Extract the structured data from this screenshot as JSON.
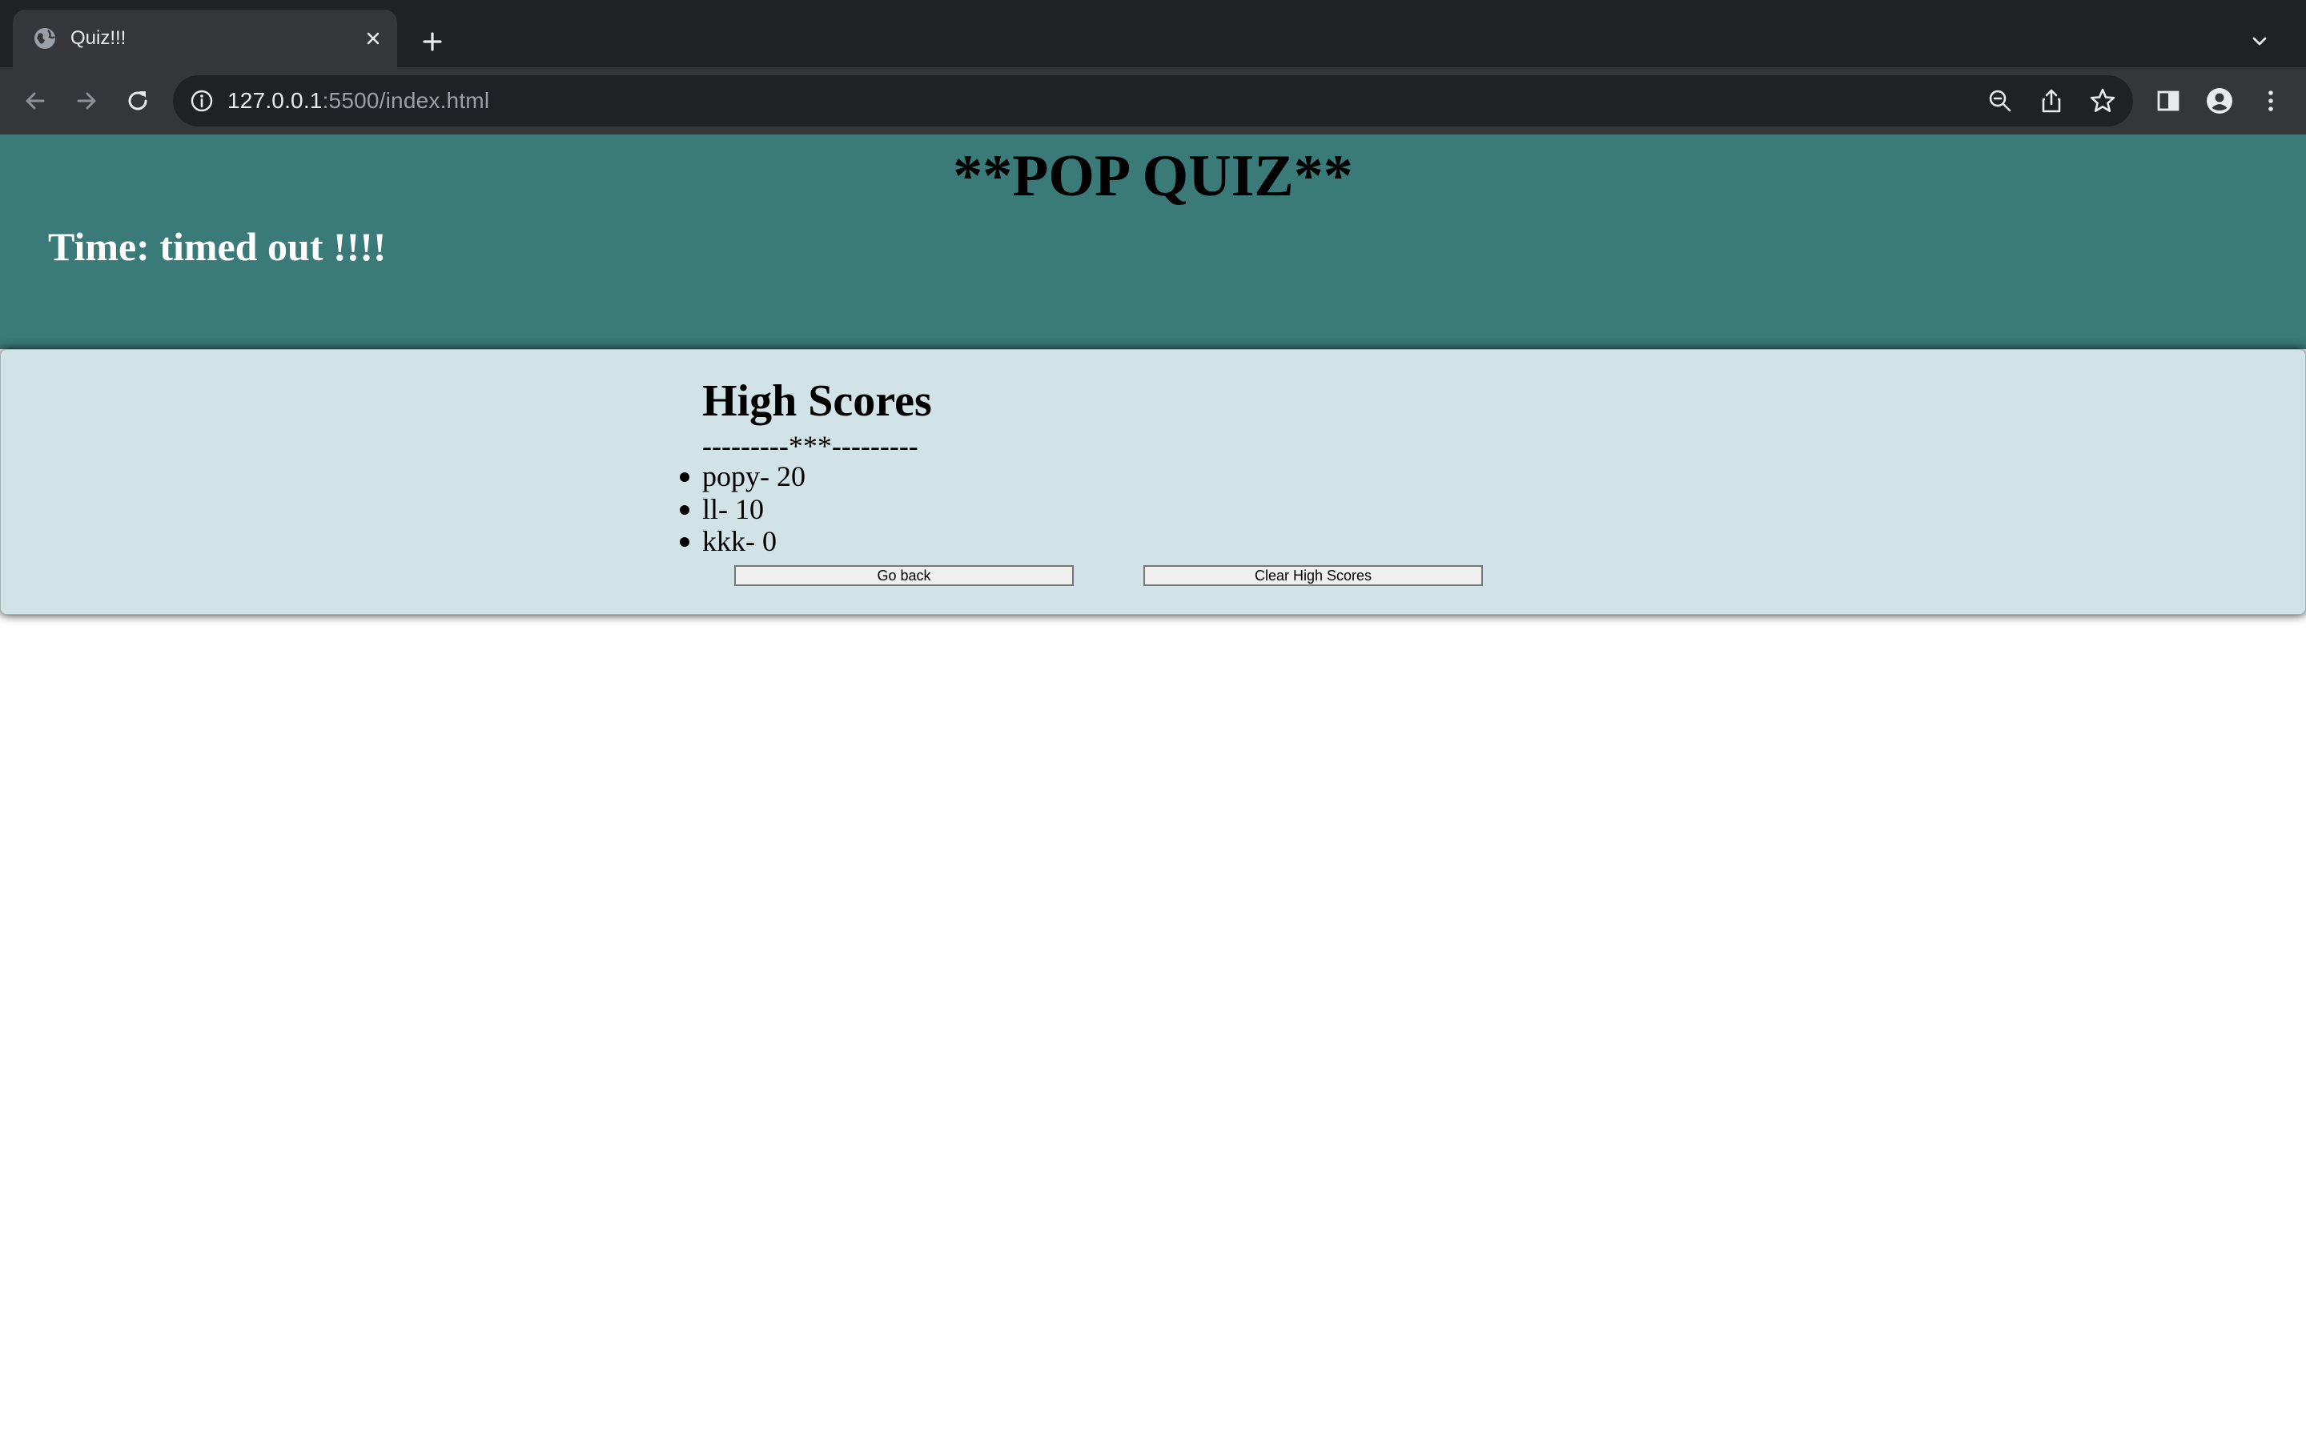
{
  "browser": {
    "tab": {
      "title": "Quiz!!!",
      "favicon": "globe-icon"
    },
    "url": {
      "host": "127.0.0.1",
      "path": ":5500/index.html"
    },
    "colors": {
      "tabstrip": "#202124",
      "toolbar": "#35363a",
      "omnibox": "#202124"
    }
  },
  "page": {
    "title": "**POP QUIZ**",
    "timer": "Time: timed out !!!!",
    "high_scores": {
      "heading": "High Scores",
      "divider": "---------***---------",
      "entries": [
        "popy- 20",
        "ll- 10",
        "kkk- 0"
      ]
    },
    "buttons": {
      "go_back": "Go back",
      "clear": "Clear High Scores"
    },
    "colors": {
      "banner": "#3a7a79",
      "card": "#d1e3e6",
      "timer_text": "#ffffff"
    }
  }
}
